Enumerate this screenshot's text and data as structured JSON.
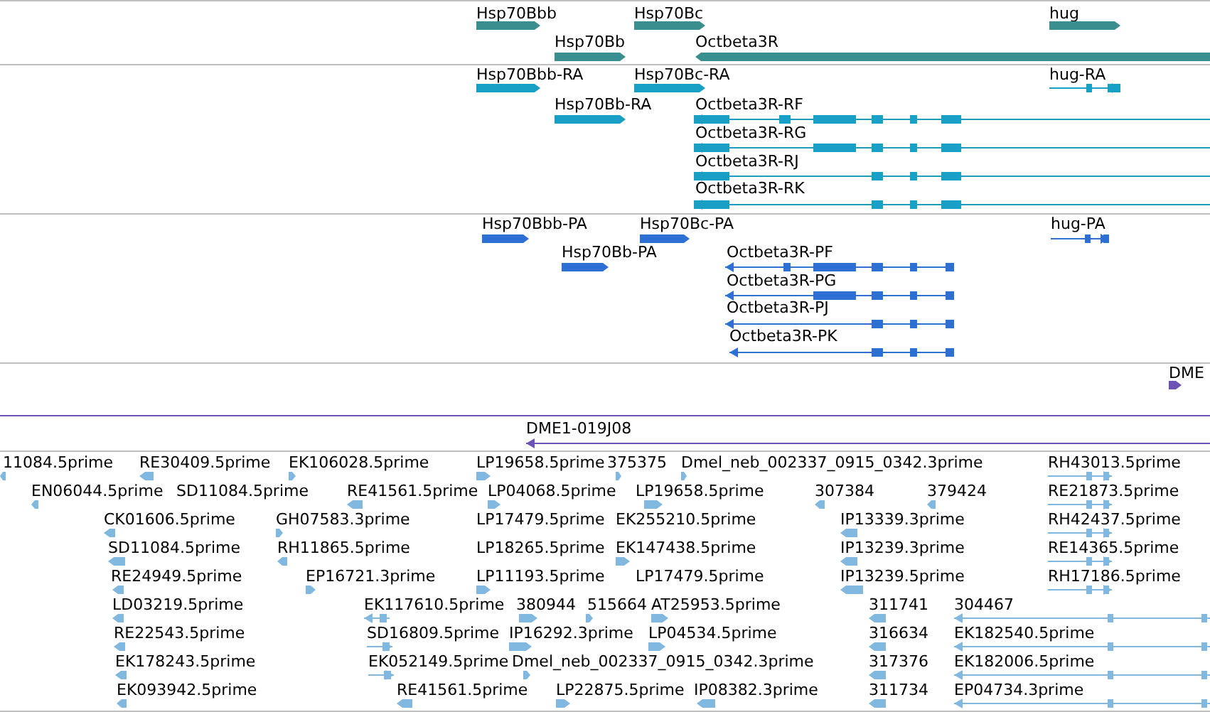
{
  "tracks": [
    {
      "kind": "gene",
      "features": [
        {
          "label": "Hsp70Bbb",
          "reverse": false
        },
        {
          "label": "Hsp70Bc",
          "reverse": false
        },
        {
          "label": "hug",
          "reverse": false
        },
        {
          "label": "Hsp70Bb",
          "reverse": false
        },
        {
          "label": "Octbeta3R",
          "reverse": true
        }
      ]
    },
    {
      "kind": "mrna",
      "features": [
        {
          "label": "Hsp70Bbb-RA",
          "reverse": false
        },
        {
          "label": "Hsp70Bc-RA",
          "reverse": false
        },
        {
          "label": "hug-RA",
          "reverse": false
        },
        {
          "label": "Hsp70Bb-RA",
          "reverse": false
        },
        {
          "label": "Octbeta3R-RF",
          "reverse": true
        },
        {
          "label": "Octbeta3R-RG",
          "reverse": true
        },
        {
          "label": "Octbeta3R-RJ",
          "reverse": true
        },
        {
          "label": "Octbeta3R-RK",
          "reverse": true
        }
      ]
    },
    {
      "kind": "protein",
      "features": [
        {
          "label": "Hsp70Bbb-PA",
          "reverse": false
        },
        {
          "label": "Hsp70Bc-PA",
          "reverse": false
        },
        {
          "label": "hug-PA",
          "reverse": false
        },
        {
          "label": "Hsp70Bb-PA",
          "reverse": false
        },
        {
          "label": "Octbeta3R-PF",
          "reverse": true
        },
        {
          "label": "Octbeta3R-PG",
          "reverse": true
        },
        {
          "label": "Octbeta3R-PJ",
          "reverse": true
        },
        {
          "label": "Octbeta3R-PK",
          "reverse": true
        }
      ]
    },
    {
      "kind": "clone",
      "features": [
        {
          "label": "DME",
          "reverse": false
        },
        {
          "label": "DME1-019J08",
          "reverse": true
        }
      ]
    },
    {
      "kind": "est",
      "features": [
        {
          "label": "11084.5prime",
          "reverse": true
        },
        {
          "label": "RE30409.5prime",
          "reverse": true
        },
        {
          "label": "EK106028.5prime",
          "reverse": false
        },
        {
          "label": "LP19658.5prime",
          "reverse": false
        },
        {
          "label": "375375",
          "reverse": false
        },
        {
          "label": "Dmel_neb_002337_0915_0342.3prime",
          "reverse": false
        },
        {
          "label": "RH43013.5prime",
          "reverse": false
        },
        {
          "label": "EN06044.5prime",
          "reverse": true
        },
        {
          "label": "SD11084.5prime"
        },
        {
          "label": "RE41561.5prime",
          "reverse": true
        },
        {
          "label": "LP04068.5prime",
          "reverse": false
        },
        {
          "label": "LP19658.5prime",
          "reverse": false
        },
        {
          "label": "307384",
          "reverse": true
        },
        {
          "label": "379424",
          "reverse": true
        },
        {
          "label": "RE21873.5prime",
          "reverse": false
        },
        {
          "label": "CK01606.5prime",
          "reverse": true
        },
        {
          "label": "GH07583.3prime",
          "reverse": false
        },
        {
          "label": "LP17479.5prime"
        },
        {
          "label": "EK255210.5prime"
        },
        {
          "label": "IP13339.3prime",
          "reverse": true
        },
        {
          "label": "RH42437.5prime",
          "reverse": false
        },
        {
          "label": "SD11084.5prime",
          "reverse": true
        },
        {
          "label": "RH11865.5prime",
          "reverse": true
        },
        {
          "label": "LP18265.5prime"
        },
        {
          "label": "EK147438.5prime",
          "reverse": false
        },
        {
          "label": "IP13239.3prime",
          "reverse": true
        },
        {
          "label": "RE14365.5prime",
          "reverse": false
        },
        {
          "label": "RE24949.5prime",
          "reverse": true
        },
        {
          "label": "EP16721.3prime",
          "reverse": false
        },
        {
          "label": "LP11193.5prime",
          "reverse": false
        },
        {
          "label": "LP17479.5prime"
        },
        {
          "label": "IP13239.5prime",
          "reverse": true
        },
        {
          "label": "RH17186.5prime",
          "reverse": false
        },
        {
          "label": "LD03219.5prime",
          "reverse": true
        },
        {
          "label": "EK117610.5prime",
          "reverse": true
        },
        {
          "label": "380944",
          "reverse": false
        },
        {
          "label": "515664",
          "reverse": false
        },
        {
          "label": "AT25953.5prime",
          "reverse": false
        },
        {
          "label": "311741",
          "reverse": true
        },
        {
          "label": "304467",
          "reverse": true
        },
        {
          "label": "RE22543.5prime",
          "reverse": true
        },
        {
          "label": "SD16809.5prime",
          "reverse": false
        },
        {
          "label": "IP16292.3prime",
          "reverse": false
        },
        {
          "label": "LP04534.5prime",
          "reverse": false
        },
        {
          "label": "316634",
          "reverse": true
        },
        {
          "label": "EK182540.5prime",
          "reverse": true
        },
        {
          "label": "EK178243.5prime",
          "reverse": true
        },
        {
          "label": "EK052149.5prime",
          "reverse": false
        },
        {
          "label": "Dmel_neb_002337_0915_0342.3prime",
          "reverse": false
        },
        {
          "label": "317376",
          "reverse": true
        },
        {
          "label": "EK182006.5prime",
          "reverse": true
        },
        {
          "label": "EK093942.5prime",
          "reverse": true
        },
        {
          "label": "RE41561.5prime",
          "reverse": true
        },
        {
          "label": "LP22875.5prime",
          "reverse": false
        },
        {
          "label": "IP08382.3prime",
          "reverse": true
        },
        {
          "label": "311734",
          "reverse": true
        },
        {
          "label": "EP04734.3prime",
          "reverse": true
        }
      ]
    }
  ]
}
